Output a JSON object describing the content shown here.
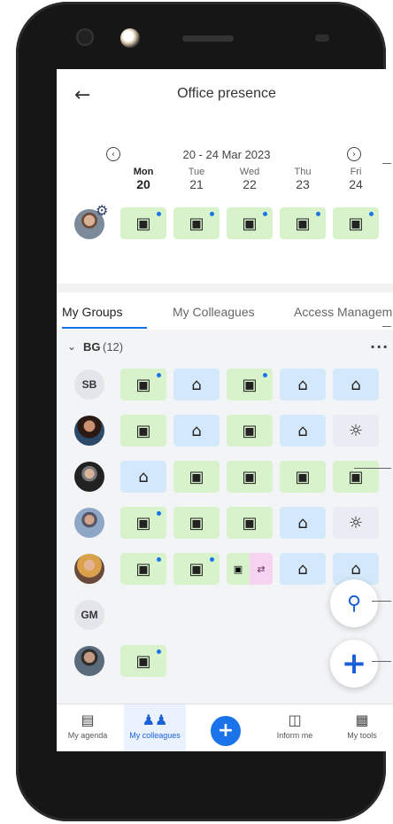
{
  "header": {
    "title": "Office presence"
  },
  "week": {
    "range": "20 - 24 Mar 2023",
    "days": [
      {
        "name": "Mon",
        "num": "20"
      },
      {
        "name": "Tue",
        "num": "21"
      },
      {
        "name": "Wed",
        "num": "22"
      },
      {
        "name": "Thu",
        "num": "23"
      },
      {
        "name": "Fri",
        "num": "24"
      }
    ]
  },
  "me": {
    "days": [
      {
        "type": "office",
        "note": true
      },
      {
        "type": "office",
        "note": true
      },
      {
        "type": "office",
        "note": true
      },
      {
        "type": "office",
        "note": true
      },
      {
        "type": "office",
        "note": true
      }
    ]
  },
  "tabs": [
    "My Groups",
    "My Colleagues",
    "Access Managem"
  ],
  "group": {
    "name": "BG",
    "count": "(12)",
    "more": "..."
  },
  "colleagues": [
    {
      "initials": "SB",
      "days": [
        "office-note",
        "home",
        "office-note",
        "home",
        "home"
      ]
    },
    {
      "initials": "",
      "days": [
        "office",
        "home",
        "office",
        "home",
        "off"
      ]
    },
    {
      "initials": "",
      "days": [
        "home",
        "office",
        "office",
        "office",
        "office"
      ]
    },
    {
      "initials": "",
      "days": [
        "office-note",
        "office",
        "office",
        "home",
        "off"
      ]
    },
    {
      "initials": "",
      "days": [
        "office-note",
        "office-note",
        "split",
        "home",
        "home"
      ]
    },
    {
      "initials": "GM",
      "days": []
    },
    {
      "initials": "",
      "days": [
        "office-note"
      ]
    }
  ],
  "nav": [
    {
      "label": "My agenda",
      "icon": "calendar-icon"
    },
    {
      "label": "My colleagues",
      "icon": "people-icon"
    },
    {
      "label": "Inform me",
      "icon": "building-icon"
    },
    {
      "label": "My tools",
      "icon": "grid-icon"
    }
  ],
  "colors": {
    "accent": "#1a73e8",
    "office": "#d8f3cc",
    "home": "#d3e8fb",
    "off": "#e9ecf2",
    "travel": "#f7d3f2"
  }
}
